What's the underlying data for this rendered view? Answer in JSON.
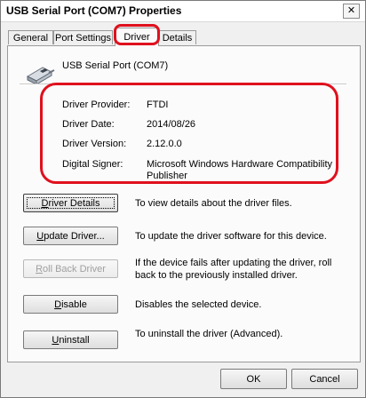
{
  "window": {
    "title": "USB Serial Port (COM7) Properties",
    "close_glyph": "✕"
  },
  "tabs": [
    {
      "label": "General",
      "active": false
    },
    {
      "label": "Port Settings",
      "active": false
    },
    {
      "label": "Driver",
      "active": true
    },
    {
      "label": "Details",
      "active": false
    }
  ],
  "device": {
    "name": "USB Serial Port (COM7)",
    "icon": "usb-connector-icon"
  },
  "driver_info": {
    "provider_label": "Driver Provider:",
    "provider_value": "FTDI",
    "date_label": "Driver Date:",
    "date_value": "2014/08/26",
    "version_label": "Driver Version:",
    "version_value": "2.12.0.0",
    "signer_label": "Digital Signer:",
    "signer_value": "Microsoft Windows Hardware Compatibility Publisher"
  },
  "buttons": [
    {
      "label_pre": "",
      "label_key": "D",
      "label_post": "river Details",
      "desc": "To view details about the driver files.",
      "enabled": true,
      "default": true
    },
    {
      "label_pre": "",
      "label_key": "U",
      "label_post": "pdate Driver...",
      "desc": "To update the driver software for this device.",
      "enabled": true,
      "default": false
    },
    {
      "label_pre": "",
      "label_key": "R",
      "label_post": "oll Back Driver",
      "desc": "If the device fails after updating the driver, roll back to the previously installed driver.",
      "enabled": false,
      "default": false
    },
    {
      "label_pre": "",
      "label_key": "D",
      "label_post": "isable",
      "desc": "Disables the selected device.",
      "enabled": true,
      "default": false
    },
    {
      "label_pre": "",
      "label_key": "U",
      "label_post": "ninstall",
      "desc": "To uninstall the driver (Advanced).",
      "enabled": true,
      "default": false
    }
  ],
  "footer": {
    "ok_label": "OK",
    "cancel_label": "Cancel"
  },
  "colors": {
    "annotation": "#e0101e",
    "window_bg": "#f0f0f0",
    "panel_bg": "#fbfbfb"
  }
}
